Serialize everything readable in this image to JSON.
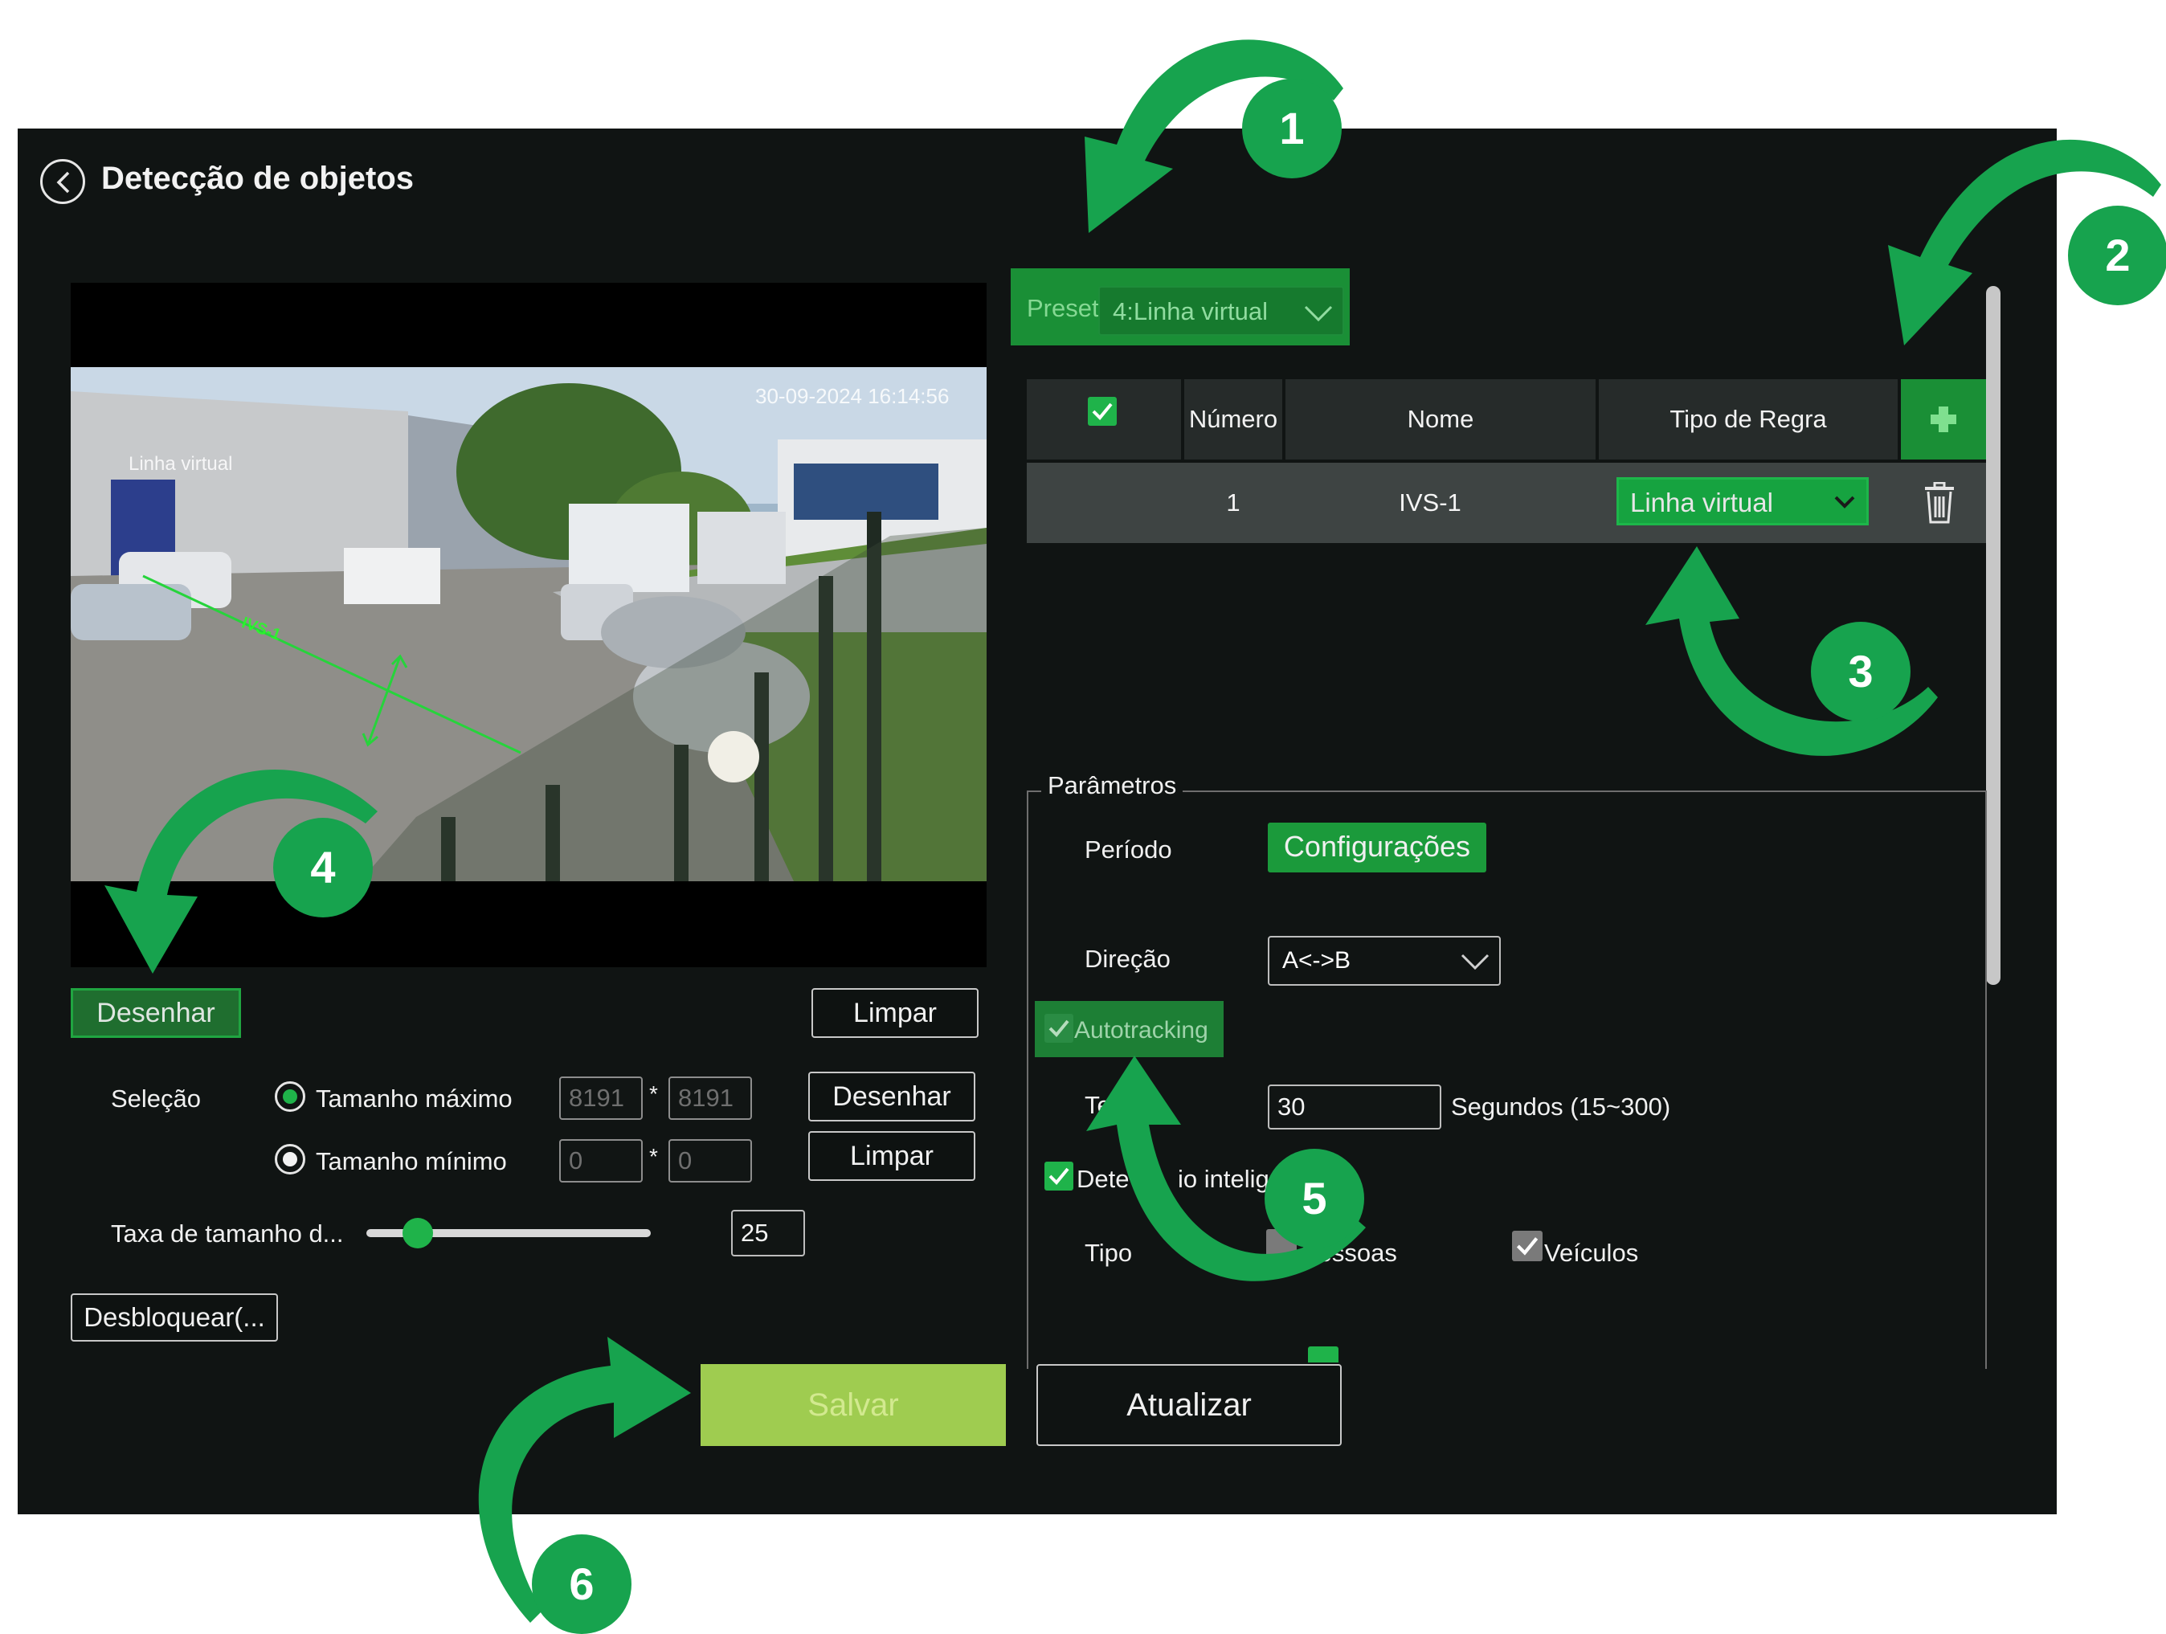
{
  "header": {
    "title": "Detecção de objetos"
  },
  "video": {
    "timestamp": "30-09-2024 16:14:56",
    "rule_overlay_label": "Linha virtual",
    "line_label": "IVS-1"
  },
  "draw_controls": {
    "draw_label": "Desenhar",
    "clear_label": "Limpar",
    "selection_label": "Seleção",
    "max_size_label": "Tamanho máximo",
    "min_size_label": "Tamanho mínimo",
    "max_w": "8191",
    "max_h": "8191",
    "min_w": "0",
    "min_h": "0",
    "times": "*",
    "draw2_label": "Desenhar",
    "clear2_label": "Limpar",
    "rate_label": "Taxa de tamanho d...",
    "rate_value": "25",
    "rate_fraction": 0.18,
    "unlock_label": "Desbloquear(..."
  },
  "preset": {
    "label": "Preset",
    "value": "4:Linha virtual"
  },
  "rules_table": {
    "columns": [
      "Número",
      "Nome",
      "Tipo de Regra"
    ],
    "rows": [
      {
        "number": "1",
        "name": "IVS-1",
        "type": "Linha virtual"
      }
    ]
  },
  "params": {
    "title": "Parâmetros",
    "period_label": "Período",
    "config_button": "Configurações",
    "direction_label": "Direção",
    "direction_value": "A<->B",
    "autotracking_label": "Autotracking",
    "time_label_partial": "Te",
    "time_value": "30",
    "time_units": "Segundos (15~300)",
    "smart_detect_partial_a": "Dete",
    "smart_detect_partial_b": "io inteliger",
    "type_label": "Tipo",
    "people_partial": "Pessoas",
    "vehicles_label": "Veículos"
  },
  "footer": {
    "save_label": "Salvar",
    "update_label": "Atualizar"
  },
  "annotations": {
    "badges": [
      "1",
      "2",
      "3",
      "4",
      "5",
      "6"
    ]
  },
  "colors": {
    "accent_green": "#1a8f36",
    "annotation_green": "#17a34e",
    "panel_bg": "#101413",
    "save_green": "#9fcc50"
  }
}
